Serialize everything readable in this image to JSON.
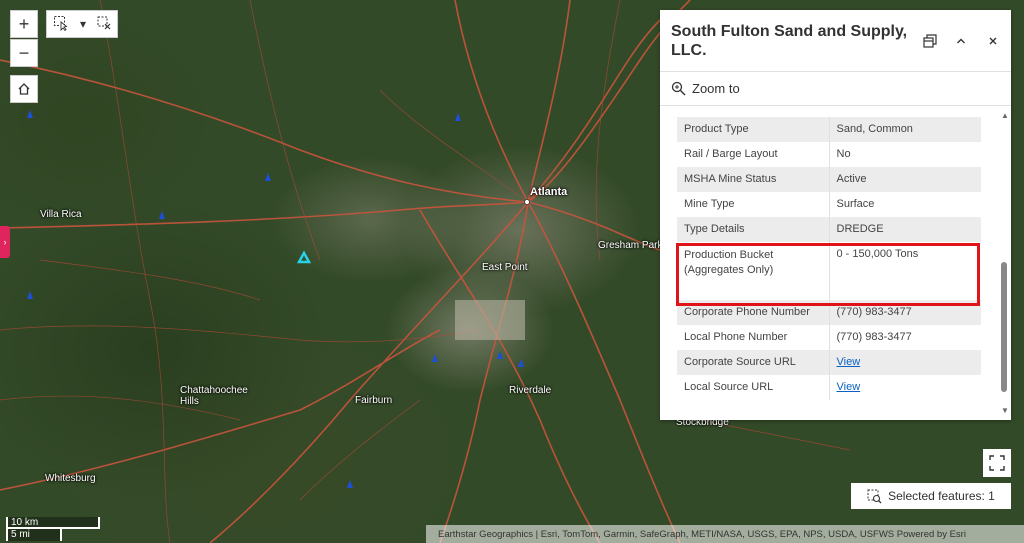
{
  "map": {
    "labels": {
      "villa_rica": "Villa Rica",
      "atlanta": "Atlanta",
      "gresham_park": "Gresham Park",
      "east_point": "East Point",
      "chattahoochee_hills": "Chattahoochee\nHills",
      "fairburn": "Fairburn",
      "riverdale": "Riverdale",
      "whitesburg": "Whitesburg",
      "stockbridge": "Stockbridge"
    },
    "controls": {
      "zoom_in": "+",
      "zoom_out": "−"
    },
    "scalebar": {
      "metric": "10 km",
      "imperial": "5 mi"
    },
    "attribution": "Earthstar Geographics | Esri, TomTom, Garmin, SafeGraph, METI/NASA, USGS, EPA, NPS, USDA, USFWS   Powered by Esri"
  },
  "popup": {
    "title": "South Fulton Sand and Supply, LLC.",
    "zoom_to_label": "Zoom to",
    "attributes": [
      {
        "label": "Product Type",
        "value": "Sand, Common"
      },
      {
        "label": "Rail / Barge Layout",
        "value": "No"
      },
      {
        "label": "MSHA Mine Status",
        "value": "Active"
      },
      {
        "label": "Mine Type",
        "value": "Surface"
      },
      {
        "label": "Type Details",
        "value": "DREDGE"
      },
      {
        "label": "Production Bucket (Aggregates Only)",
        "value": "0 - 150,000 Tons"
      },
      {
        "label": "Corporate Phone Number",
        "value": "(770) 983-3477"
      },
      {
        "label": "Local Phone Number",
        "value": "(770) 983-3477"
      },
      {
        "label": "Corporate Source URL",
        "value": "View"
      },
      {
        "label": "Local Source URL",
        "value": "View"
      }
    ]
  },
  "selected_features_label": "Selected features: 1",
  "colors": {
    "highlight": "#e0131a",
    "link": "#0b61c4",
    "selection": "#27d2e8"
  }
}
